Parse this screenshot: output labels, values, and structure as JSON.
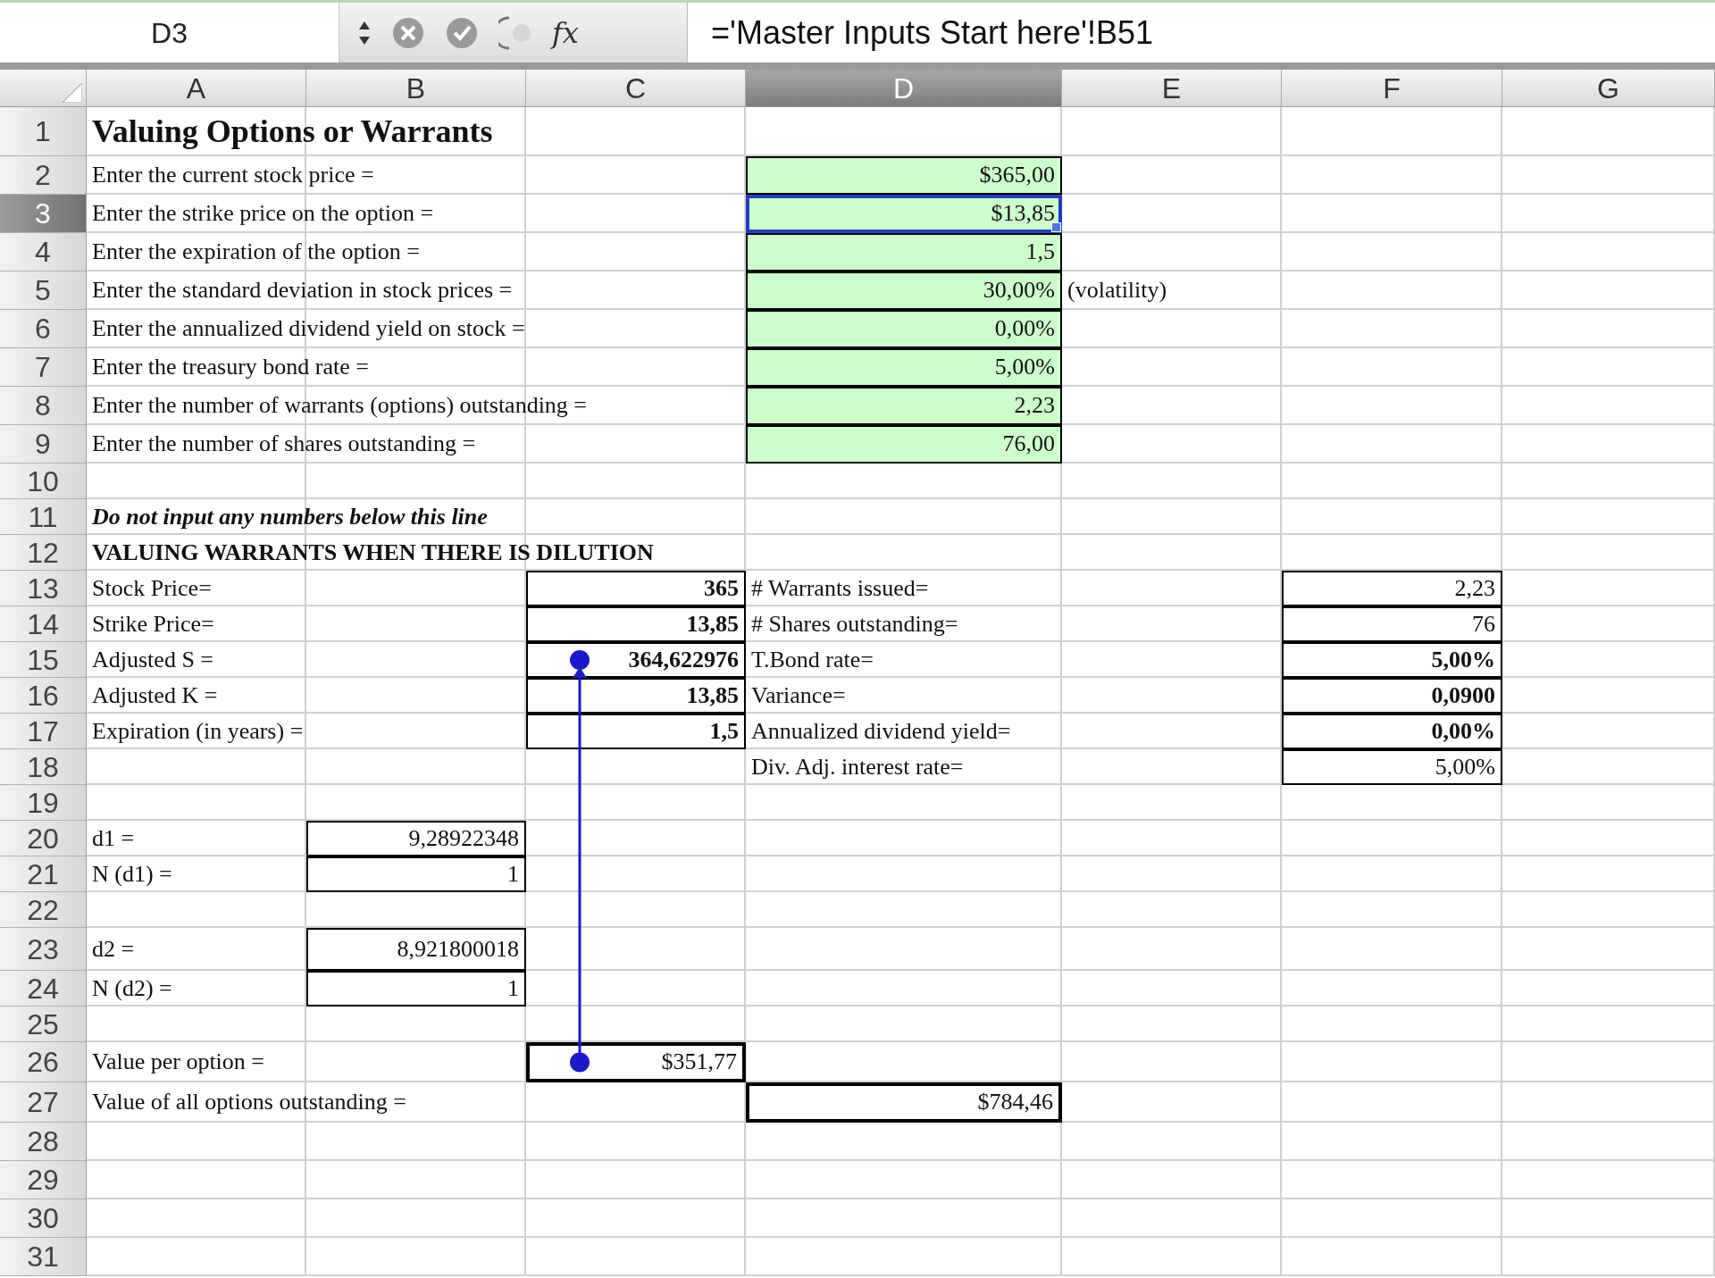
{
  "formula_bar": {
    "name_box": "D3",
    "function_label": "fx",
    "formula": "='Master Inputs Start here'!B51"
  },
  "columns": [
    {
      "label": "A",
      "selected": false
    },
    {
      "label": "B",
      "selected": false
    },
    {
      "label": "C",
      "selected": false
    },
    {
      "label": "D",
      "selected": true
    },
    {
      "label": "E",
      "selected": false
    },
    {
      "label": "F",
      "selected": false
    },
    {
      "label": "G",
      "selected": false
    }
  ],
  "rows": [
    {
      "label": "1",
      "selected": false,
      "cells": {
        "A": {
          "kind": "title",
          "text": "Valuing Options or Warrants",
          "bold": true
        }
      }
    },
    {
      "label": "2",
      "selected": false,
      "cells": {
        "A": {
          "kind": "label",
          "text": "Enter the current stock price ="
        },
        "D": {
          "kind": "number",
          "text": "$365,00",
          "input": true,
          "boxed": true
        }
      }
    },
    {
      "label": "3",
      "selected": true,
      "cells": {
        "A": {
          "kind": "label",
          "text": "Enter the strike price on the option ="
        },
        "D": {
          "kind": "number",
          "text": "$13,85",
          "input": true,
          "boxed": true
        }
      }
    },
    {
      "label": "4",
      "selected": false,
      "cells": {
        "A": {
          "kind": "label",
          "text": "Enter the expiration of the option ="
        },
        "D": {
          "kind": "number",
          "text": "1,5",
          "input": true,
          "boxed": true
        }
      }
    },
    {
      "label": "5",
      "selected": false,
      "cells": {
        "A": {
          "kind": "label",
          "text": "Enter the standard deviation in stock prices ="
        },
        "D": {
          "kind": "number",
          "text": "30,00%",
          "input": true,
          "boxed": true
        },
        "E": {
          "kind": "label",
          "text": "(volatility)"
        }
      }
    },
    {
      "label": "6",
      "selected": false,
      "cells": {
        "A": {
          "kind": "label",
          "text": "Enter the annualized dividend yield on stock ="
        },
        "D": {
          "kind": "number",
          "text": "0,00%",
          "input": true,
          "boxed": true
        }
      }
    },
    {
      "label": "7",
      "selected": false,
      "cells": {
        "A": {
          "kind": "label",
          "text": "Enter the treasury bond rate ="
        },
        "D": {
          "kind": "number",
          "text": "5,00%",
          "input": true,
          "boxed": true
        }
      }
    },
    {
      "label": "8",
      "selected": false,
      "cells": {
        "A": {
          "kind": "label",
          "text": "Enter the number of warrants (options) outstanding ="
        },
        "D": {
          "kind": "number",
          "text": "2,23",
          "input": true,
          "boxed": true
        }
      }
    },
    {
      "label": "9",
      "selected": false,
      "cells": {
        "A": {
          "kind": "label",
          "text": "Enter the number of shares outstanding ="
        },
        "D": {
          "kind": "number",
          "text": "76,00",
          "input": true,
          "boxed": true
        }
      }
    },
    {
      "label": "10",
      "selected": false,
      "cells": {}
    },
    {
      "label": "11",
      "selected": false,
      "cells": {
        "A": {
          "kind": "label",
          "text": "Do not input any numbers below this line",
          "bold": true,
          "italic": true
        }
      }
    },
    {
      "label": "12",
      "selected": false,
      "cells": {
        "A": {
          "kind": "label",
          "text": "VALUING WARRANTS WHEN THERE IS DILUTION",
          "bold": true
        }
      }
    },
    {
      "label": "13",
      "selected": false,
      "cells": {
        "A": {
          "kind": "label",
          "text": "Stock Price="
        },
        "C": {
          "kind": "number",
          "text": "365",
          "bold": true,
          "boxed": true
        },
        "D": {
          "kind": "label",
          "text": "# Warrants issued="
        },
        "F": {
          "kind": "number",
          "text": "2,23",
          "boxed": true
        }
      }
    },
    {
      "label": "14",
      "selected": false,
      "cells": {
        "A": {
          "kind": "label",
          "text": "Strike Price="
        },
        "C": {
          "kind": "number",
          "text": "13,85",
          "bold": true,
          "boxed": true
        },
        "D": {
          "kind": "label",
          "text": "# Shares outstanding="
        },
        "F": {
          "kind": "number",
          "text": "76",
          "boxed": true
        }
      }
    },
    {
      "label": "15",
      "selected": false,
      "cells": {
        "A": {
          "kind": "label",
          "text": "Adjusted S ="
        },
        "C": {
          "kind": "number",
          "text": "364,622976",
          "bold": true,
          "boxed": true,
          "trace_target": true
        },
        "D": {
          "kind": "label",
          "text": "T.Bond rate="
        },
        "F": {
          "kind": "number",
          "text": "5,00%",
          "bold": true,
          "boxed": true
        }
      }
    },
    {
      "label": "16",
      "selected": false,
      "cells": {
        "A": {
          "kind": "label",
          "text": "Adjusted K ="
        },
        "C": {
          "kind": "number",
          "text": "13,85",
          "bold": true,
          "boxed": true
        },
        "D": {
          "kind": "label",
          "text": "Variance="
        },
        "F": {
          "kind": "number",
          "text": "0,0900",
          "bold": true,
          "boxed": true
        }
      }
    },
    {
      "label": "17",
      "selected": false,
      "cells": {
        "A": {
          "kind": "label",
          "text": "Expiration (in years) ="
        },
        "C": {
          "kind": "number",
          "text": "1,5",
          "bold": true,
          "boxed": true
        },
        "D": {
          "kind": "label",
          "text": "Annualized dividend yield="
        },
        "F": {
          "kind": "number",
          "text": "0,00%",
          "bold": true,
          "boxed": true
        }
      }
    },
    {
      "label": "18",
      "selected": false,
      "cells": {
        "D": {
          "kind": "label",
          "text": "Div. Adj. interest rate="
        },
        "F": {
          "kind": "number",
          "text": "5,00%",
          "boxed": true
        }
      }
    },
    {
      "label": "19",
      "selected": false,
      "cells": {}
    },
    {
      "label": "20",
      "selected": false,
      "cells": {
        "A": {
          "kind": "label",
          "text": "d1 ="
        },
        "B": {
          "kind": "number",
          "text": "9,28922348",
          "boxed": true
        }
      }
    },
    {
      "label": "21",
      "selected": false,
      "cells": {
        "A": {
          "kind": "label",
          "text": "N (d1) ="
        },
        "B": {
          "kind": "number",
          "text": "1",
          "boxed": true
        }
      }
    },
    {
      "label": "22",
      "selected": false,
      "cells": {}
    },
    {
      "label": "23",
      "selected": false,
      "cells": {
        "A": {
          "kind": "label",
          "text": "d2 ="
        },
        "B": {
          "kind": "number",
          "text": "8,921800018",
          "boxed": true
        }
      }
    },
    {
      "label": "24",
      "selected": false,
      "cells": {
        "A": {
          "kind": "label",
          "text": "N (d2) ="
        },
        "B": {
          "kind": "number",
          "text": "1",
          "boxed": true
        }
      }
    },
    {
      "label": "25",
      "selected": false,
      "cells": {}
    },
    {
      "label": "26",
      "selected": false,
      "cells": {
        "A": {
          "kind": "label",
          "text": "Value per option ="
        },
        "C": {
          "kind": "number",
          "text": "$351,77",
          "boxed": true,
          "heavy": true,
          "trace_source": true
        }
      }
    },
    {
      "label": "27",
      "selected": false,
      "cells": {
        "A": {
          "kind": "label",
          "text": "Value of all options outstanding ="
        },
        "D": {
          "kind": "number",
          "text": "$784,46",
          "boxed": true,
          "heavy": true
        }
      }
    },
    {
      "label": "28",
      "selected": false,
      "cells": {}
    },
    {
      "label": "29",
      "selected": false,
      "cells": {}
    },
    {
      "label": "30",
      "selected": false,
      "cells": {}
    },
    {
      "label": "31",
      "selected": false,
      "cells": {}
    }
  ]
}
